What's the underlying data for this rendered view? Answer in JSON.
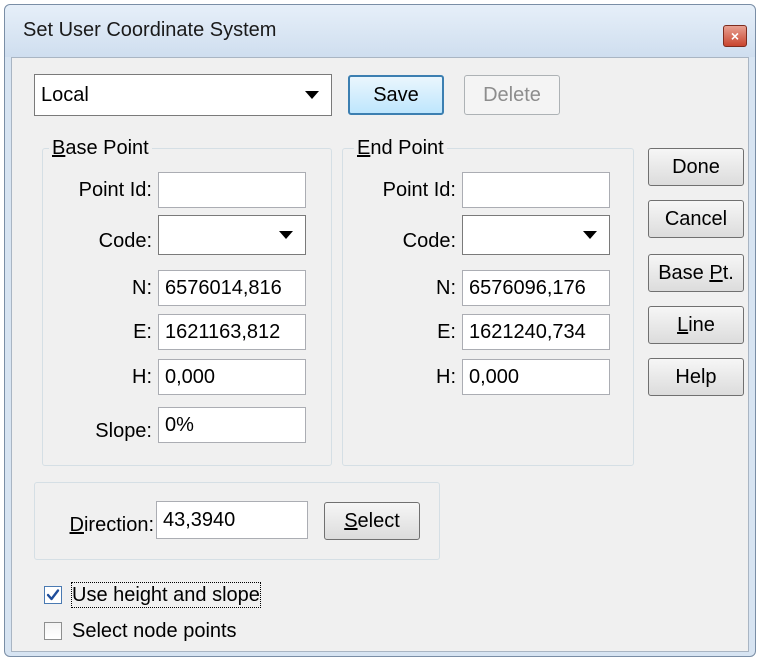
{
  "window": {
    "title": "Set User Coordinate System",
    "close_glyph": "×"
  },
  "system_combo": {
    "value": "Local"
  },
  "top_buttons": {
    "save": "Save",
    "delete": "Delete"
  },
  "base_point": {
    "group_label": "Base Point",
    "point_id_label": "Point Id:",
    "point_id": "",
    "code_label": "Code:",
    "code": "",
    "n_label": "N:",
    "n": "6576014,816",
    "e_label": "E:",
    "e": "1621163,812",
    "h_label": "H:",
    "h": "0,000",
    "slope_label": "Slope:",
    "slope": "0%"
  },
  "end_point": {
    "group_label": "End Point",
    "point_id_label": "Point Id:",
    "point_id": "",
    "code_label": "Code:",
    "code": "",
    "n_label": "N:",
    "n": "6576096,176",
    "e_label": "E:",
    "e": "1621240,734",
    "h_label": "H:",
    "h": "0,000"
  },
  "side_buttons": {
    "done": "Done",
    "cancel": "Cancel",
    "base_pt": "Base Pt.",
    "line": "Line",
    "help": "Help"
  },
  "direction": {
    "label": "Direction:",
    "value": "43,3940",
    "select_button": "Select"
  },
  "options": {
    "use_height_and_slope": {
      "label": "Use height and slope",
      "checked": true
    },
    "select_node_points": {
      "label": "Select node points",
      "checked": false
    }
  },
  "colors": {
    "titlebar": "#d7e4f2",
    "client": "#f0f0f0",
    "close": "#c9452f",
    "checkmark": "#1f4e9b"
  },
  "icons": {
    "dropdown": "chevron-down-icon",
    "close": "close-icon",
    "check": "checkmark-icon"
  }
}
